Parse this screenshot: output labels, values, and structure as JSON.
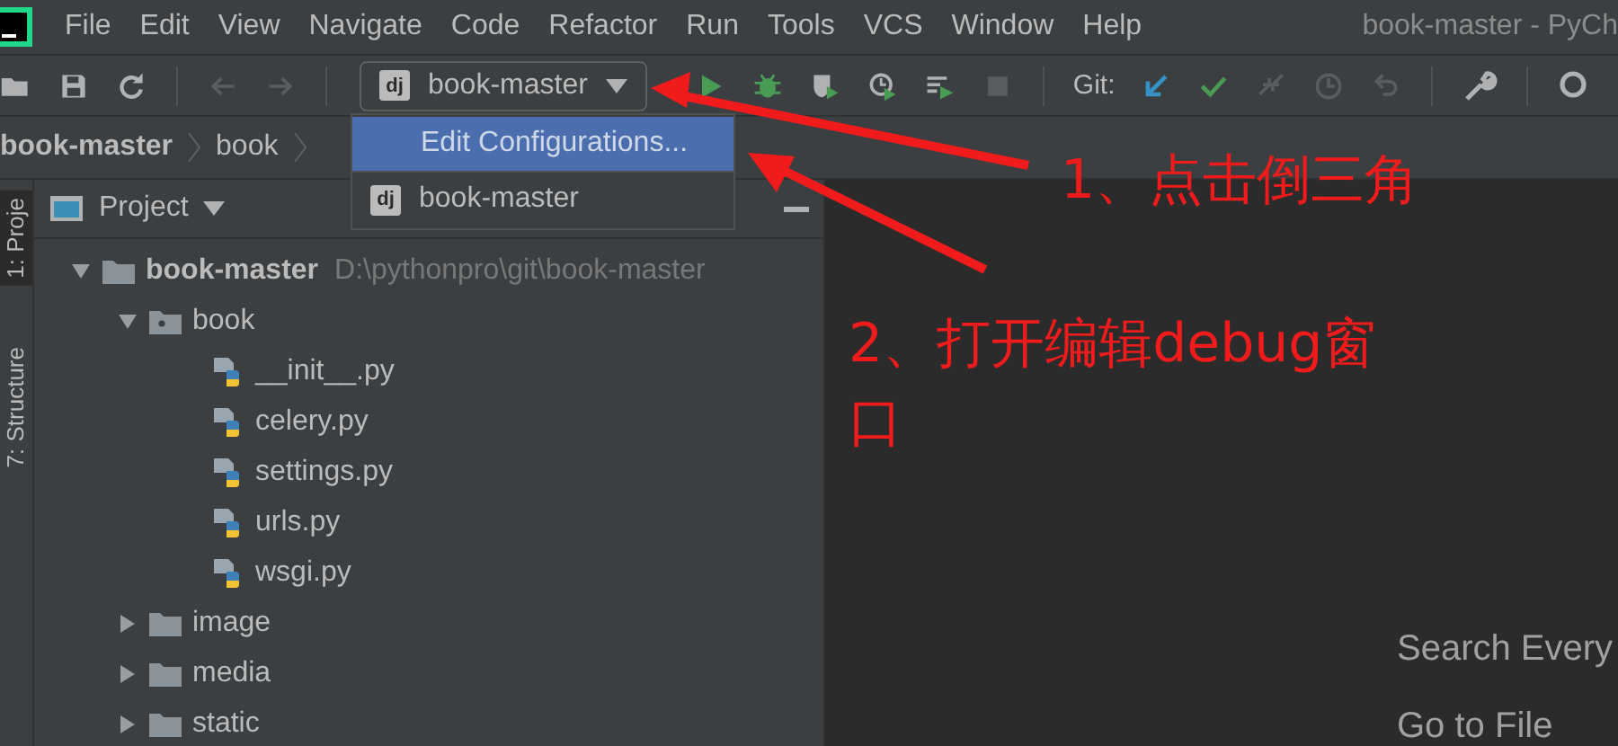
{
  "window": {
    "title": "book-master - PyCh"
  },
  "menu": [
    "File",
    "Edit",
    "View",
    "Navigate",
    "Code",
    "Refactor",
    "Run",
    "Tools",
    "VCS",
    "Window",
    "Help"
  ],
  "toolbar": [
    {
      "kind": "open",
      "disabled": false
    },
    {
      "kind": "save",
      "disabled": false
    },
    {
      "kind": "sync",
      "disabled": false
    },
    {
      "kind": "back",
      "disabled": true
    },
    {
      "kind": "forward",
      "disabled": true
    }
  ],
  "run_config": {
    "icon": "dj",
    "label": "book-master",
    "expanded": true
  },
  "run_tools": [
    {
      "kind": "run",
      "disabled": false
    },
    {
      "kind": "debug",
      "disabled": false
    },
    {
      "kind": "coverage",
      "disabled": false
    },
    {
      "kind": "profile",
      "disabled": false
    },
    {
      "kind": "concurrency",
      "disabled": false
    },
    {
      "kind": "stop",
      "disabled": true
    }
  ],
  "git": {
    "label": "Git:",
    "tools": [
      {
        "kind": "update",
        "disabled": false
      },
      {
        "kind": "commit",
        "disabled": false
      },
      {
        "kind": "merge",
        "disabled": true
      },
      {
        "kind": "history",
        "disabled": true
      },
      {
        "kind": "revert",
        "disabled": true
      }
    ]
  },
  "breadcrumb": [
    {
      "label": "book-master"
    },
    {
      "label": "book"
    }
  ],
  "dropdown": [
    {
      "label": "Edit Configurations...",
      "kind": "action",
      "selected": true
    },
    {
      "label": "book-master",
      "kind": "config",
      "icon": "dj",
      "selected": false
    }
  ],
  "side_tabs": [
    {
      "label": "1: Proje",
      "selected": true
    },
    {
      "label": "7: Structure",
      "selected": false
    }
  ],
  "project_panel": {
    "title": "Project"
  },
  "tree": [
    {
      "label": "book-master",
      "path": "D:\\pythonpro\\git\\book-master",
      "kind": "module",
      "expanded": true,
      "children": [
        {
          "label": "book",
          "kind": "package",
          "expanded": true,
          "children": [
            {
              "label": "__init__.py",
              "kind": "python"
            },
            {
              "label": "celery.py",
              "kind": "python"
            },
            {
              "label": "settings.py",
              "kind": "python"
            },
            {
              "label": "urls.py",
              "kind": "python"
            },
            {
              "label": "wsgi.py",
              "kind": "python"
            }
          ]
        },
        {
          "label": "image",
          "kind": "folder",
          "expanded": false
        },
        {
          "label": "media",
          "kind": "folder",
          "expanded": false
        },
        {
          "label": "static",
          "kind": "folder",
          "expanded": false
        }
      ]
    }
  ],
  "editor_hints": [
    "Search Every",
    "Go to File"
  ],
  "annotations": [
    {
      "label": "1、点击倒三角"
    },
    {
      "label": "2、打开编辑debug窗口"
    }
  ]
}
